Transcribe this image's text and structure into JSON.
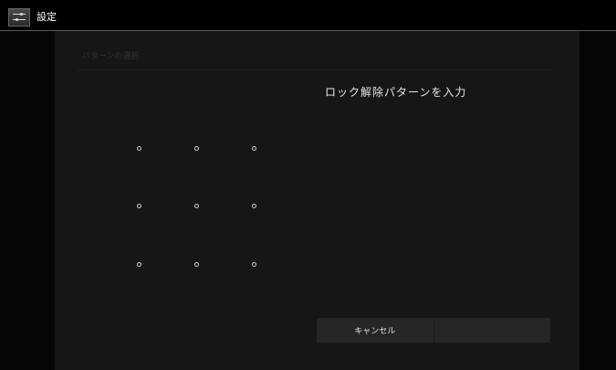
{
  "header": {
    "title": "設定",
    "icon": "settings-sliders-icon"
  },
  "panel": {
    "title": "パターンの選択",
    "prompt": "ロック解除パターンを入力"
  },
  "pattern": {
    "rows": 3,
    "cols": 3
  },
  "buttons": {
    "cancel": "キャンセル",
    "continue": ""
  }
}
